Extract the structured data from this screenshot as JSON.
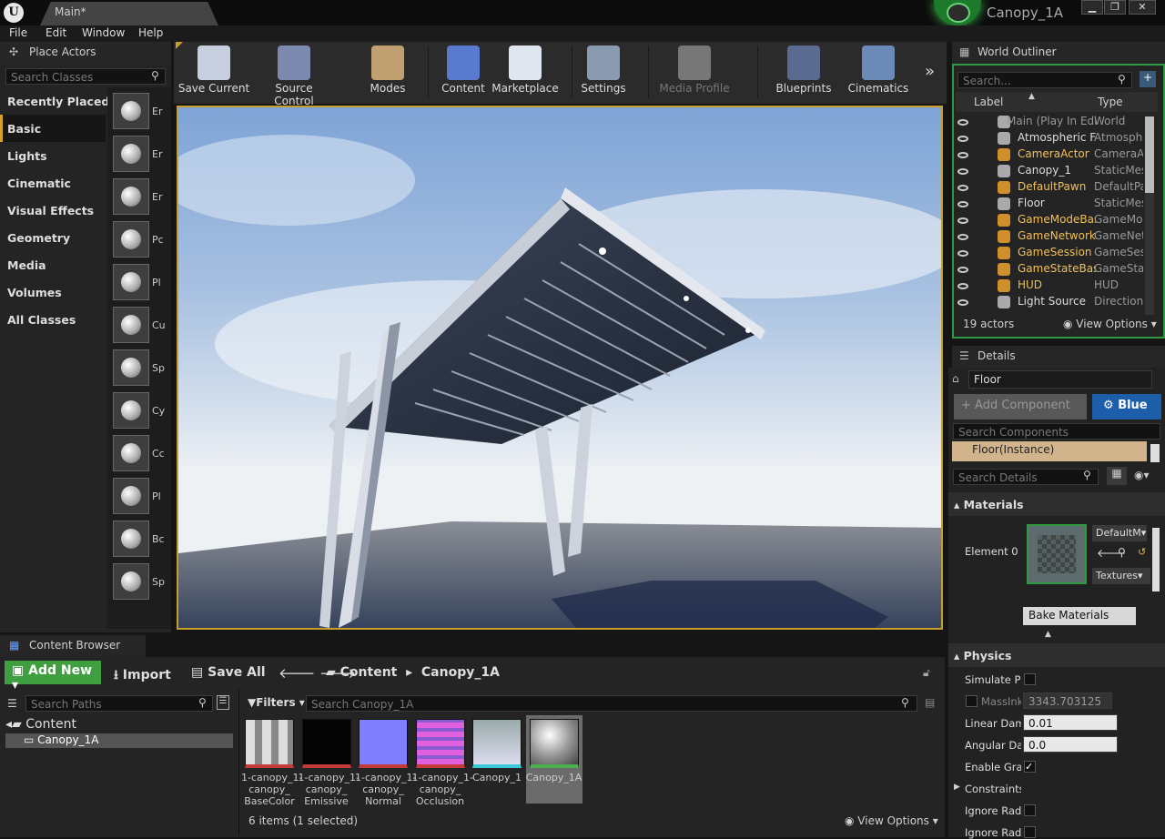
{
  "title_bar": {
    "tab": "Main*",
    "project": "Canopy_1A"
  },
  "menu": [
    "File",
    "Edit",
    "Window",
    "Help"
  ],
  "place_actors": {
    "tab": "Place Actors",
    "search_placeholder": "Search Classes",
    "categories": [
      "Recently Placed",
      "Basic",
      "Lights",
      "Cinematic",
      "Visual Effects",
      "Geometry",
      "Media",
      "Volumes",
      "All Classes"
    ],
    "selected": "Basic",
    "asset_labels": [
      "Er",
      "Er",
      "Er",
      "Pc",
      "Pl",
      "Cu",
      "Sp",
      "Cy",
      "Cc",
      "Pl",
      "Bc",
      "Sp"
    ]
  },
  "toolbar": [
    "Save Current",
    "Source Control",
    "Modes",
    "Content",
    "Marketplace",
    "Settings",
    "Media Profile",
    "Blueprints",
    "Cinematics"
  ],
  "outliner": {
    "tab": "World Outliner",
    "search_placeholder": "Search...",
    "col_label": "Label",
    "col_type": "Type",
    "rows": [
      {
        "label": "Main (Play In Edit",
        "type": "World",
        "style": "dim"
      },
      {
        "label": "Atmospheric Fo",
        "type": "Atmosphe",
        "style": "normal"
      },
      {
        "label": "CameraActor",
        "type": "CameraAc",
        "style": "gold"
      },
      {
        "label": "Canopy_1",
        "type": "StaticMes",
        "style": "normal"
      },
      {
        "label": "DefaultPawn",
        "type": "DefaultPa",
        "style": "gold"
      },
      {
        "label": "Floor",
        "type": "StaticMes",
        "style": "normal"
      },
      {
        "label": "GameModeBase",
        "type": "GameMod",
        "style": "gold"
      },
      {
        "label": "GameNetworkM",
        "type": "GameNetv",
        "style": "gold"
      },
      {
        "label": "GameSession",
        "type": "GameSess",
        "style": "gold"
      },
      {
        "label": "GameStateBase",
        "type": "GameStat",
        "style": "gold"
      },
      {
        "label": "HUD",
        "type": "HUD",
        "style": "gold"
      },
      {
        "label": "Light Source",
        "type": "Directiona",
        "style": "normal"
      }
    ],
    "count": "19 actors",
    "view_options": "View Options"
  },
  "details": {
    "tab": "Details",
    "actor_name": "Floor",
    "add_component": "+ Add Component",
    "blueprint_btn": "Blue",
    "search_components": "Search Components",
    "component": "Floor(Instance)",
    "search_details": "Search Details",
    "materials_header": "Materials",
    "element_label": "Element 0",
    "material_name": "DefaultM",
    "textures_btn": "Textures",
    "bake_btn": "Bake Materials",
    "physics_header": "Physics",
    "physics_rows": [
      {
        "label": "Simulate Ph",
        "kind": "check",
        "value": ""
      },
      {
        "label": "MassInk",
        "kind": "field-dim",
        "value": "3343.703125"
      },
      {
        "label": "Linear Damp",
        "kind": "field",
        "value": "0.01"
      },
      {
        "label": "Angular Dan",
        "kind": "field",
        "value": "0.0"
      },
      {
        "label": "Enable Grav",
        "kind": "checked",
        "value": ""
      },
      {
        "label": "Constraints",
        "kind": "expand",
        "value": ""
      },
      {
        "label": "Ignore Radia",
        "kind": "check",
        "value": ""
      },
      {
        "label": "Ignore Radia",
        "kind": "check",
        "value": ""
      }
    ]
  },
  "content_browser": {
    "tab": "Content Browser",
    "add_new": "Add New",
    "import": "Import",
    "save_all": "Save All",
    "path": [
      "Content",
      "Canopy_1A"
    ],
    "search_paths": "Search Paths",
    "filters": "Filters",
    "search_assets": "Search Canopy_1A",
    "tree": [
      "Content",
      "Canopy_1A"
    ],
    "assets": [
      {
        "label": "1-canopy_1-\ncanopy_\nBaseColor",
        "bar": "#c43a3a"
      },
      {
        "label": "1-canopy_1-\ncanopy_\nEmissive",
        "bar": "#c43a3a"
      },
      {
        "label": "1-canopy_1-\ncanopy_\nNormal",
        "bar": "#c43a3a"
      },
      {
        "label": "1-canopy_1-\ncanopy_\nOcclusion",
        "bar": "#c43a3a"
      },
      {
        "label": "Canopy_1",
        "bar": "#3ac8d8"
      },
      {
        "label": "Canopy_1A",
        "bar": "#4caf50"
      }
    ],
    "status": "6 items (1 selected)",
    "view_options": "View Options"
  }
}
